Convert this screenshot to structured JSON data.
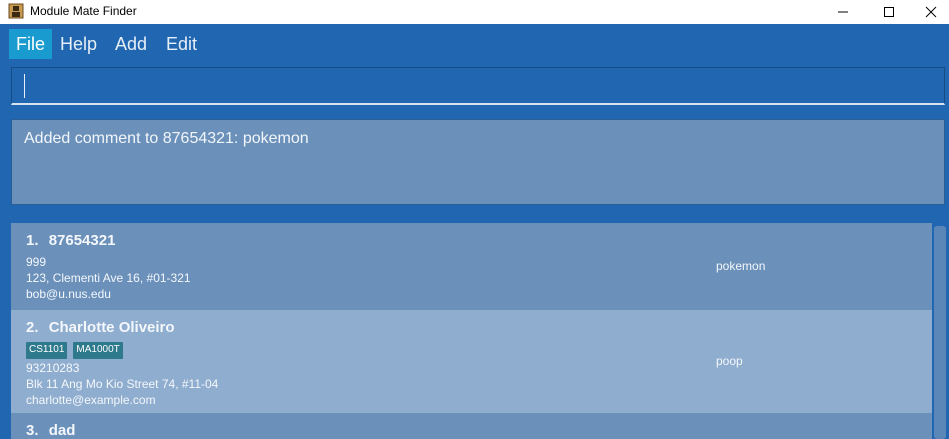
{
  "window": {
    "title": "Module Mate Finder",
    "minimize_glyph": "—",
    "maximize_glyph": "☐",
    "close_glyph": "✕"
  },
  "menu": {
    "items": [
      {
        "label": "File"
      },
      {
        "label": "Help"
      },
      {
        "label": "Add"
      },
      {
        "label": "Edit"
      }
    ]
  },
  "command": {
    "value": "",
    "placeholder": ""
  },
  "result": {
    "message": "Added comment to 87654321: pokemon"
  },
  "persons": [
    {
      "index": "1.",
      "name": "87654321",
      "tags": [],
      "phone": "999",
      "address": "123, Clementi Ave 16, #01-321",
      "email": "bob@u.nus.edu",
      "comment": "pokemon"
    },
    {
      "index": "2.",
      "name": "Charlotte Oliveiro",
      "tags": [
        "CS1101",
        "MA1000T"
      ],
      "phone": "93210283",
      "address": "Blk 11 Ang Mo Kio Street 74, #11-04",
      "email": "charlotte@example.com",
      "comment": "poop"
    },
    {
      "index": "3.",
      "name": "dad"
    }
  ],
  "colors": {
    "background": "#2166b0",
    "menu_active": "#1a9bd0",
    "card_odd": "#6b91bb",
    "card_even": "#8fadce",
    "tag": "#2e7a8c"
  }
}
